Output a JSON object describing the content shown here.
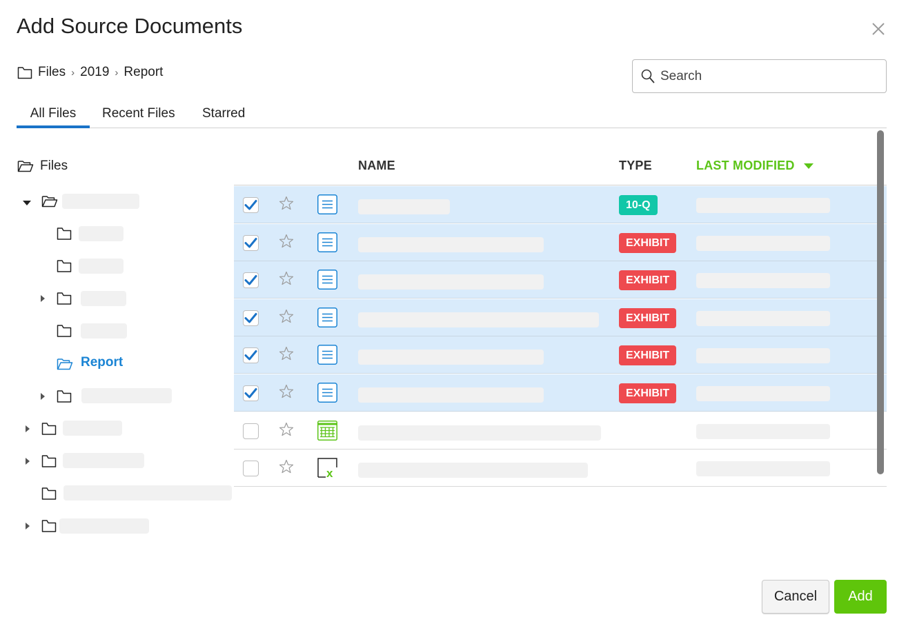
{
  "dialog": {
    "title": "Add Source Documents"
  },
  "breadcrumb": {
    "items": [
      "Files",
      "2019",
      "Report"
    ]
  },
  "search": {
    "placeholder": "Search",
    "value": ""
  },
  "tabs": [
    {
      "label": "All Files",
      "active": true
    },
    {
      "label": "Recent Files",
      "active": false
    },
    {
      "label": "Starred",
      "active": false
    }
  ],
  "tree": {
    "root_label": "Files",
    "selected_folder_label": "Report"
  },
  "table": {
    "columns": {
      "name": "NAME",
      "type": "TYPE",
      "last_modified": "LAST MODIFIED"
    },
    "sort_column": "LAST MODIFIED",
    "sort_direction": "descending",
    "rows": [
      {
        "checked": true,
        "starred": false,
        "icon": "document-icon",
        "type": "10-Q"
      },
      {
        "checked": true,
        "starred": false,
        "icon": "document-icon",
        "type": "EXHIBIT"
      },
      {
        "checked": true,
        "starred": false,
        "icon": "document-icon",
        "type": "EXHIBIT"
      },
      {
        "checked": true,
        "starred": false,
        "icon": "document-icon",
        "type": "EXHIBIT"
      },
      {
        "checked": true,
        "starred": false,
        "icon": "document-icon",
        "type": "EXHIBIT"
      },
      {
        "checked": true,
        "starred": false,
        "icon": "document-icon",
        "type": "EXHIBIT"
      },
      {
        "checked": false,
        "starred": false,
        "icon": "spreadsheet-icon",
        "type": ""
      },
      {
        "checked": false,
        "starred": false,
        "icon": "excel-file-icon",
        "type": ""
      }
    ]
  },
  "buttons": {
    "cancel": "Cancel",
    "add": "Add"
  },
  "colors": {
    "accent_blue": "#1a84d4",
    "selected_row": "#d9ebfb",
    "sort_green": "#5cc418",
    "add_green": "#5fc50b",
    "badge_teal": "#12c7a8",
    "badge_red": "#ee4a4f"
  }
}
